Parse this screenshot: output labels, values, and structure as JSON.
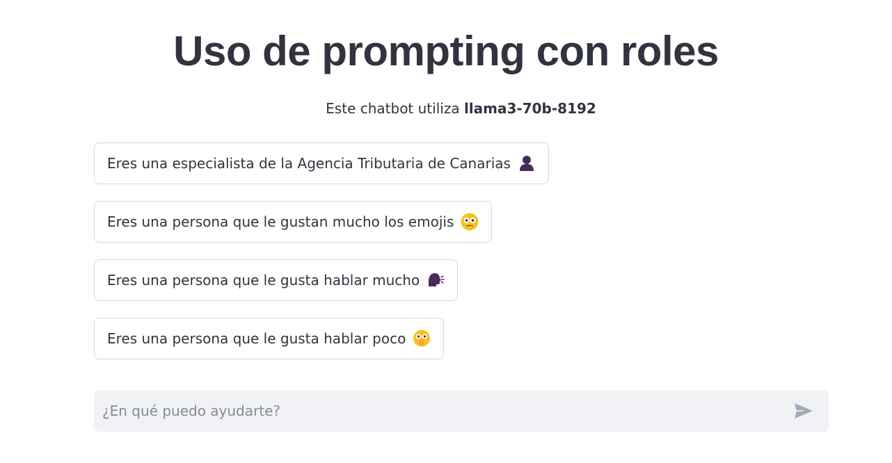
{
  "header": {
    "title": "Uso de prompting con roles",
    "subtitle_prefix": "Este chatbot utiliza ",
    "model_name": "llama3-70b-8192"
  },
  "roles": [
    {
      "label": "Eres una especialista de la Agencia Tributaria de Canarias",
      "icon": "person-silhouette-icon"
    },
    {
      "label": "Eres una persona que le gustan mucho los emojis",
      "icon": "flushed-face-icon"
    },
    {
      "label": "Eres una persona que le gusta hablar mucho",
      "icon": "speaking-head-icon"
    },
    {
      "label": "Eres una persona que le gusta hablar poco",
      "icon": "shushing-face-icon"
    }
  ],
  "chat_input": {
    "placeholder": "¿En qué puedo ayudarte?",
    "value": ""
  },
  "colors": {
    "text": "#31333f",
    "button_border": "#d5d7dd",
    "input_background": "#f0f2f6",
    "send_icon": "#a3a8b8",
    "emoji_purple": "#4a2a5a",
    "emoji_yellow": "#f8c21c"
  }
}
